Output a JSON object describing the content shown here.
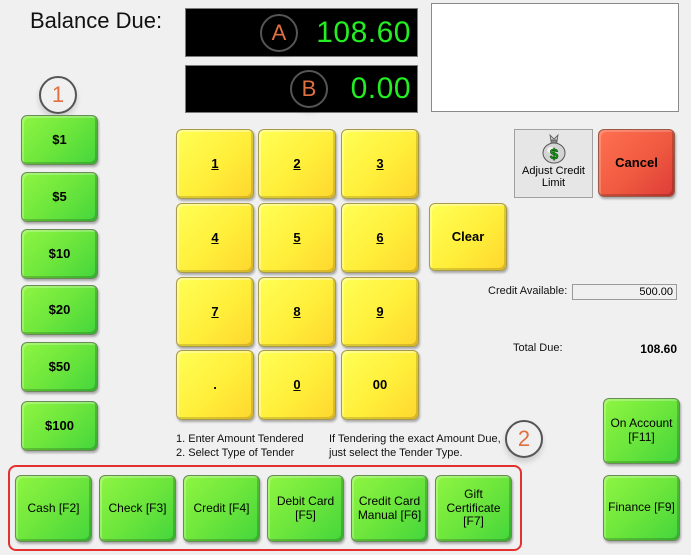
{
  "header": {
    "balance_label": "Balance Due:",
    "display_a": {
      "callout": "A",
      "value": "108.60"
    },
    "display_b": {
      "callout": "B",
      "value": "0.00"
    }
  },
  "callouts": {
    "one": "1",
    "two": "2"
  },
  "quick_cash": [
    {
      "label": "$1"
    },
    {
      "label": "$5"
    },
    {
      "label": "$10"
    },
    {
      "label": "$20"
    },
    {
      "label": "$50"
    },
    {
      "label": "$100"
    }
  ],
  "keypad": {
    "keys": [
      "1",
      "2",
      "3",
      "4",
      "5",
      "6",
      "7",
      "8",
      "9",
      ".",
      "0",
      "00"
    ],
    "clear_label": "Clear"
  },
  "actions": {
    "adjust_credit_label": "Adjust Credit Limit",
    "adjust_credit_icon": "money-bag-icon",
    "cancel_label": "Cancel"
  },
  "summary": {
    "credit_available_label": "Credit Available:",
    "credit_available_value": "500.00",
    "total_due_label": "Total Due:",
    "total_due_value": "108.60"
  },
  "instructions": {
    "step1": "1. Enter Amount Tendered",
    "step2": "2. Select Type of Tender",
    "note_line1": "If Tendering the exact Amount Due,",
    "note_line2": "just select the Tender Type."
  },
  "tender_types": [
    {
      "line1": "Cash [F2]",
      "line2": ""
    },
    {
      "line1": "Check [F3]",
      "line2": ""
    },
    {
      "line1": "Credit [F4]",
      "line2": ""
    },
    {
      "line1": "Debit Card",
      "line2": "[F5]"
    },
    {
      "line1": "Credit Card",
      "line2": "Manual [F6]"
    },
    {
      "line1": "Gift Certificate",
      "line2": "[F7]"
    }
  ],
  "side_buttons": {
    "on_account_line1": "On Account",
    "on_account_line2": "[F11]",
    "finance_label": "Finance [F9]"
  },
  "colors": {
    "display_text": "#22ee22",
    "callout_text": "#e07040",
    "highlight_border": "#e53030"
  }
}
